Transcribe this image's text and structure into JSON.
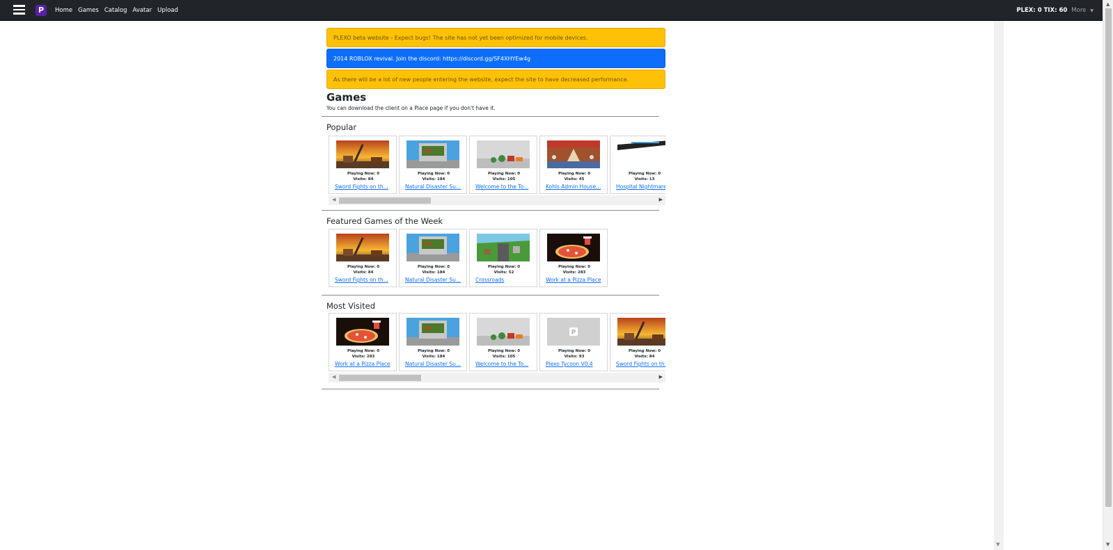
{
  "nav": {
    "links": [
      "Home",
      "Games",
      "Catalog",
      "Avatar",
      "Upload"
    ],
    "currency": "PLEX: 0 TIX: 60",
    "more": "More"
  },
  "alerts": [
    {
      "text": "PLEXO beta website - Expect bugs! The site has not yet been optimized for mobile devices.",
      "type": "warning"
    },
    {
      "text": "2014 ROBLOX revival. Join the discord: https://discord.gg/SF4XHYEw4g",
      "type": "primary"
    },
    {
      "text": "As there will be a lot of new people entering the website, expect the site to have decreased performance.",
      "type": "warning"
    }
  ],
  "page": {
    "title": "Games",
    "subtitle": "You can download the client on a Place page if you don't have it."
  },
  "sections": {
    "popular": {
      "title": "Popular",
      "games": [
        {
          "name": "Sword Fights on th...",
          "playing": "Playing Now: 0",
          "visits": "Visits: 84",
          "thumb": "sunset-icon"
        },
        {
          "name": "Natural Disaster Su...",
          "playing": "Playing Now: 0",
          "visits": "Visits: 184",
          "thumb": "island-icon"
        },
        {
          "name": "Welcome to the To...",
          "playing": "Playing Now: 0",
          "visits": "Visits: 105",
          "thumb": "town-icon"
        },
        {
          "name": "Kohls Admin House...",
          "playing": "Playing Now: 0",
          "visits": "Visits: 45",
          "thumb": "house-icon"
        },
        {
          "name": "Hospital Nightmare",
          "playing": "Playing Now: 0",
          "visits": "Visits: 13",
          "thumb": "hospital-icon"
        }
      ]
    },
    "featured": {
      "title": "Featured Games of the Week",
      "games": [
        {
          "name": "Sword Fights on th...",
          "playing": "Playing Now: 0",
          "visits": "Visits: 84",
          "thumb": "sunset-icon"
        },
        {
          "name": "Natural Disaster Su...",
          "playing": "Playing Now: 0",
          "visits": "Visits: 184",
          "thumb": "island-icon"
        },
        {
          "name": "Crossroads",
          "playing": "Playing Now: 0",
          "visits": "Visits: 52",
          "thumb": "crossroads-icon"
        },
        {
          "name": "Work at a Pizza Place",
          "playing": "Playing Now: 0",
          "visits": "Visits: 283",
          "thumb": "pizza-icon"
        }
      ]
    },
    "most_visited": {
      "title": "Most Visited",
      "games": [
        {
          "name": "Work at a Pizza Place",
          "playing": "Playing Now: 0",
          "visits": "Visits: 283",
          "thumb": "pizza-icon"
        },
        {
          "name": "Natural Disaster Su...",
          "playing": "Playing Now: 0",
          "visits": "Visits: 184",
          "thumb": "island-icon"
        },
        {
          "name": "Welcome to the To...",
          "playing": "Playing Now: 0",
          "visits": "Visits: 105",
          "thumb": "town-icon"
        },
        {
          "name": "Plexo Tycoon V0.4",
          "playing": "Playing Now: 0",
          "visits": "Visits: 93",
          "thumb": "placeholder-logo-icon"
        },
        {
          "name": "Sword Fights on th...",
          "playing": "Playing Now: 0",
          "visits": "Visits: 84",
          "thumb": "sunset-icon"
        }
      ]
    }
  },
  "colors": {
    "navbar": "#212529",
    "warning": "#ffc107",
    "primary": "#0d6efd",
    "link": "#0d6efd"
  }
}
